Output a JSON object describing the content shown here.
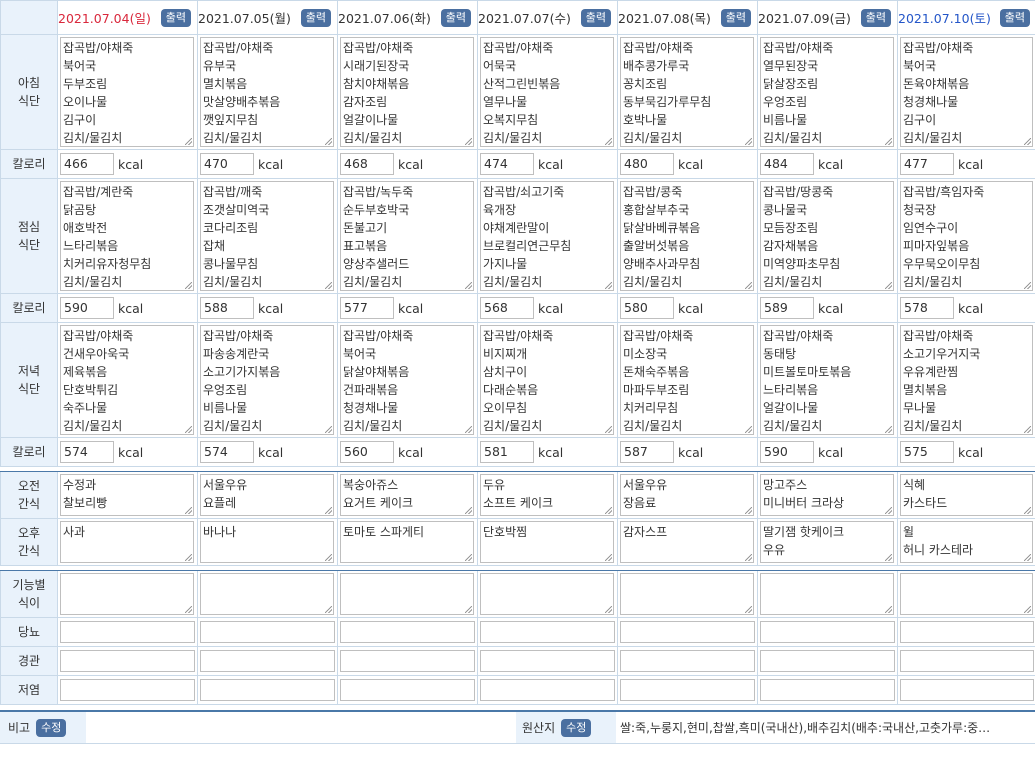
{
  "buttons": {
    "print": "출력",
    "edit": "수정"
  },
  "days": [
    {
      "date": "2021.07.04(일)",
      "kind": "sun"
    },
    {
      "date": "2021.07.05(월)",
      "kind": ""
    },
    {
      "date": "2021.07.06(화)",
      "kind": ""
    },
    {
      "date": "2021.07.07(수)",
      "kind": ""
    },
    {
      "date": "2021.07.08(목)",
      "kind": ""
    },
    {
      "date": "2021.07.09(금)",
      "kind": ""
    },
    {
      "date": "2021.07.10(토)",
      "kind": "sat"
    }
  ],
  "labels": {
    "breakfast": [
      "아침",
      "식단"
    ],
    "lunch": [
      "점심",
      "식단"
    ],
    "dinner": [
      "저녁",
      "식단"
    ],
    "calorie": "칼로리",
    "unit": "kcal",
    "am_snack": [
      "오전",
      "간식"
    ],
    "pm_snack": [
      "오후",
      "간식"
    ],
    "functional": [
      "기능별",
      "식이"
    ],
    "diabetes": "당뇨",
    "tube": "경관",
    "low_salt": "저염",
    "remarks": "비고",
    "origin": "원산지"
  },
  "breakfast": [
    [
      "잡곡밥/야채죽",
      "북어국",
      "두부조림",
      "오이나물",
      "김구이",
      "김치/물김치"
    ],
    [
      "잡곡밥/야채죽",
      "유부국",
      "멸치볶음",
      "맛살양배추볶음",
      "깻잎지무침",
      "김치/물김치"
    ],
    [
      "잡곡밥/야채죽",
      "시래기된장국",
      "참치야채볶음",
      "감자조림",
      "얼갈이나물",
      "김치/물김치"
    ],
    [
      "잡곡밥/야채죽",
      "어묵국",
      "산적그린빈볶음",
      "열무나물",
      "오복지무침",
      "김치/물김치"
    ],
    [
      "잡곡밥/야채죽",
      "배추콩가루국",
      "꽁치조림",
      "동부묵김가루무침",
      "호박나물",
      "김치/물김치"
    ],
    [
      "잡곡밥/야채죽",
      "열무된장국",
      "닭살장조림",
      "우엉조림",
      "비름나물",
      "김치/물김치"
    ],
    [
      "잡곡밥/야채죽",
      "북어국",
      "돈육야채볶음",
      "청경채나물",
      "김구이",
      "김치/물김치"
    ]
  ],
  "breakfast_cal": [
    "466",
    "470",
    "468",
    "474",
    "480",
    "484",
    "477"
  ],
  "lunch": [
    [
      "잡곡밥/계란죽",
      "닭곰탕",
      "애호박전",
      "느타리볶음",
      "치커리유자청무침",
      "김치/물김치"
    ],
    [
      "잡곡밥/깨죽",
      "조갯살미역국",
      "코다리조림",
      "잡채",
      "콩나물무침",
      "김치/물김치"
    ],
    [
      "잡곡밥/녹두죽",
      "순두부호박국",
      "돈불고기",
      "표고볶음",
      "양상추샐러드",
      "김치/물김치"
    ],
    [
      "잡곡밥/쇠고기죽",
      "육개장",
      "야채계란말이",
      "브로컬리연근무침",
      "가지나물",
      "김치/물김치"
    ],
    [
      "잡곡밥/콩죽",
      "홍합살부추국",
      "닭살바베큐볶음",
      "출알버섯볶음",
      "양배추사과무침",
      "김치/물김치"
    ],
    [
      "잡곡밥/땅콩죽",
      "콩나물국",
      "모듬장조림",
      "감자채볶음",
      "미역양파초무침",
      "김치/물김치"
    ],
    [
      "잡곡밥/흑임자죽",
      "청국장",
      "임연수구이",
      "피마자잎볶음",
      "우무묵오이무침",
      "김치/물김치"
    ]
  ],
  "lunch_cal": [
    "590",
    "588",
    "577",
    "568",
    "580",
    "589",
    "578"
  ],
  "dinner": [
    [
      "잡곡밥/야채죽",
      "건새우아욱국",
      "제육볶음",
      "단호박튀김",
      "숙주나물",
      "김치/물김치"
    ],
    [
      "잡곡밥/야채죽",
      "파송송계란국",
      "소고기가지볶음",
      "우엉조림",
      "비름나물",
      "김치/물김치"
    ],
    [
      "잡곡밥/야채죽",
      "북어국",
      "닭살야채볶음",
      "건파래볶음",
      "청경채나물",
      "김치/물김치"
    ],
    [
      "잡곡밥/야채죽",
      "비지찌개",
      "삼치구이",
      "다래순볶음",
      "오이무침",
      "김치/물김치"
    ],
    [
      "잡곡밥/야채죽",
      "미소장국",
      "돈채숙주볶음",
      "마파두부조림",
      "치커리무침",
      "김치/물김치"
    ],
    [
      "잡곡밥/야채죽",
      "동태탕",
      "미트볼토마토볶음",
      "느타리볶음",
      "얼갈이나물",
      "김치/물김치"
    ],
    [
      "잡곡밥/야채죽",
      "소고기우거지국",
      "우유계란찜",
      "멸치볶음",
      "무나물",
      "김치/물김치"
    ]
  ],
  "dinner_cal": [
    "574",
    "574",
    "560",
    "581",
    "587",
    "590",
    "575"
  ],
  "am_snack": [
    [
      "수정과",
      "찰보리빵"
    ],
    [
      "서울우유",
      "요플레"
    ],
    [
      "복숭아쥬스",
      "요거트 케이크"
    ],
    [
      "두유",
      "소프트 케이크"
    ],
    [
      "서울우유",
      "장음료"
    ],
    [
      "망고주스",
      "미니버터 크라상"
    ],
    [
      "식혜",
      "카스타드"
    ]
  ],
  "pm_snack": [
    [
      "사과"
    ],
    [
      "바나나"
    ],
    [
      "토마토 스파게티"
    ],
    [
      "단호박찜"
    ],
    [
      "감자스프"
    ],
    [
      "딸기잼 핫케이크",
      "우유"
    ],
    [
      "윌",
      "허니 카스테라"
    ]
  ],
  "remarks_value": "",
  "origin_value": "쌀:죽,누룽지,현미,찹쌀,흑미(국내산),배추김치(배추:국내산,고춧가루:중…"
}
